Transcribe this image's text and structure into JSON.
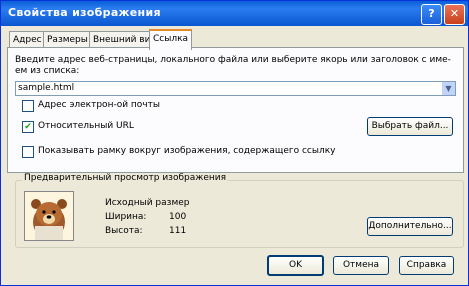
{
  "window": {
    "title": "Свойства изображения",
    "help_glyph": "?",
    "close_glyph": "✕"
  },
  "tabs": [
    {
      "label": "Адрес"
    },
    {
      "label": "Размеры"
    },
    {
      "label": "Внешний вид"
    },
    {
      "label": "Ссылка"
    }
  ],
  "link_tab": {
    "instruction": "Введите адрес веб-страницы, локального файла или выберите якорь или заголовок с име-ем из списка:",
    "url_value": "sample.html",
    "email_checkbox_label": "Адрес электрон-ой почты",
    "email_checked": false,
    "relative_url_label": "Относительный URL",
    "relative_url_checked": true,
    "choose_file_button": "Выбрать файл...",
    "border_checkbox_label": "Показывать рамку вокруг изображения, содержащего ссылку",
    "border_checked": false
  },
  "preview": {
    "group_title": "Предварительный просмотр изображения",
    "original_size_label": "Исходный размер",
    "width_label": "Ширина:",
    "width_value": "100",
    "height_label": "Высота:",
    "height_value": "111",
    "advanced_button": "Дополнительно..."
  },
  "buttons": {
    "ok": "OK",
    "cancel": "Отмена",
    "help": "Справка"
  },
  "colors": {
    "titlebar": "#0a5fd8",
    "accent_tab": "#e68b2c",
    "checkmark": "#21a121",
    "dialog_bg": "#ece9d8"
  }
}
